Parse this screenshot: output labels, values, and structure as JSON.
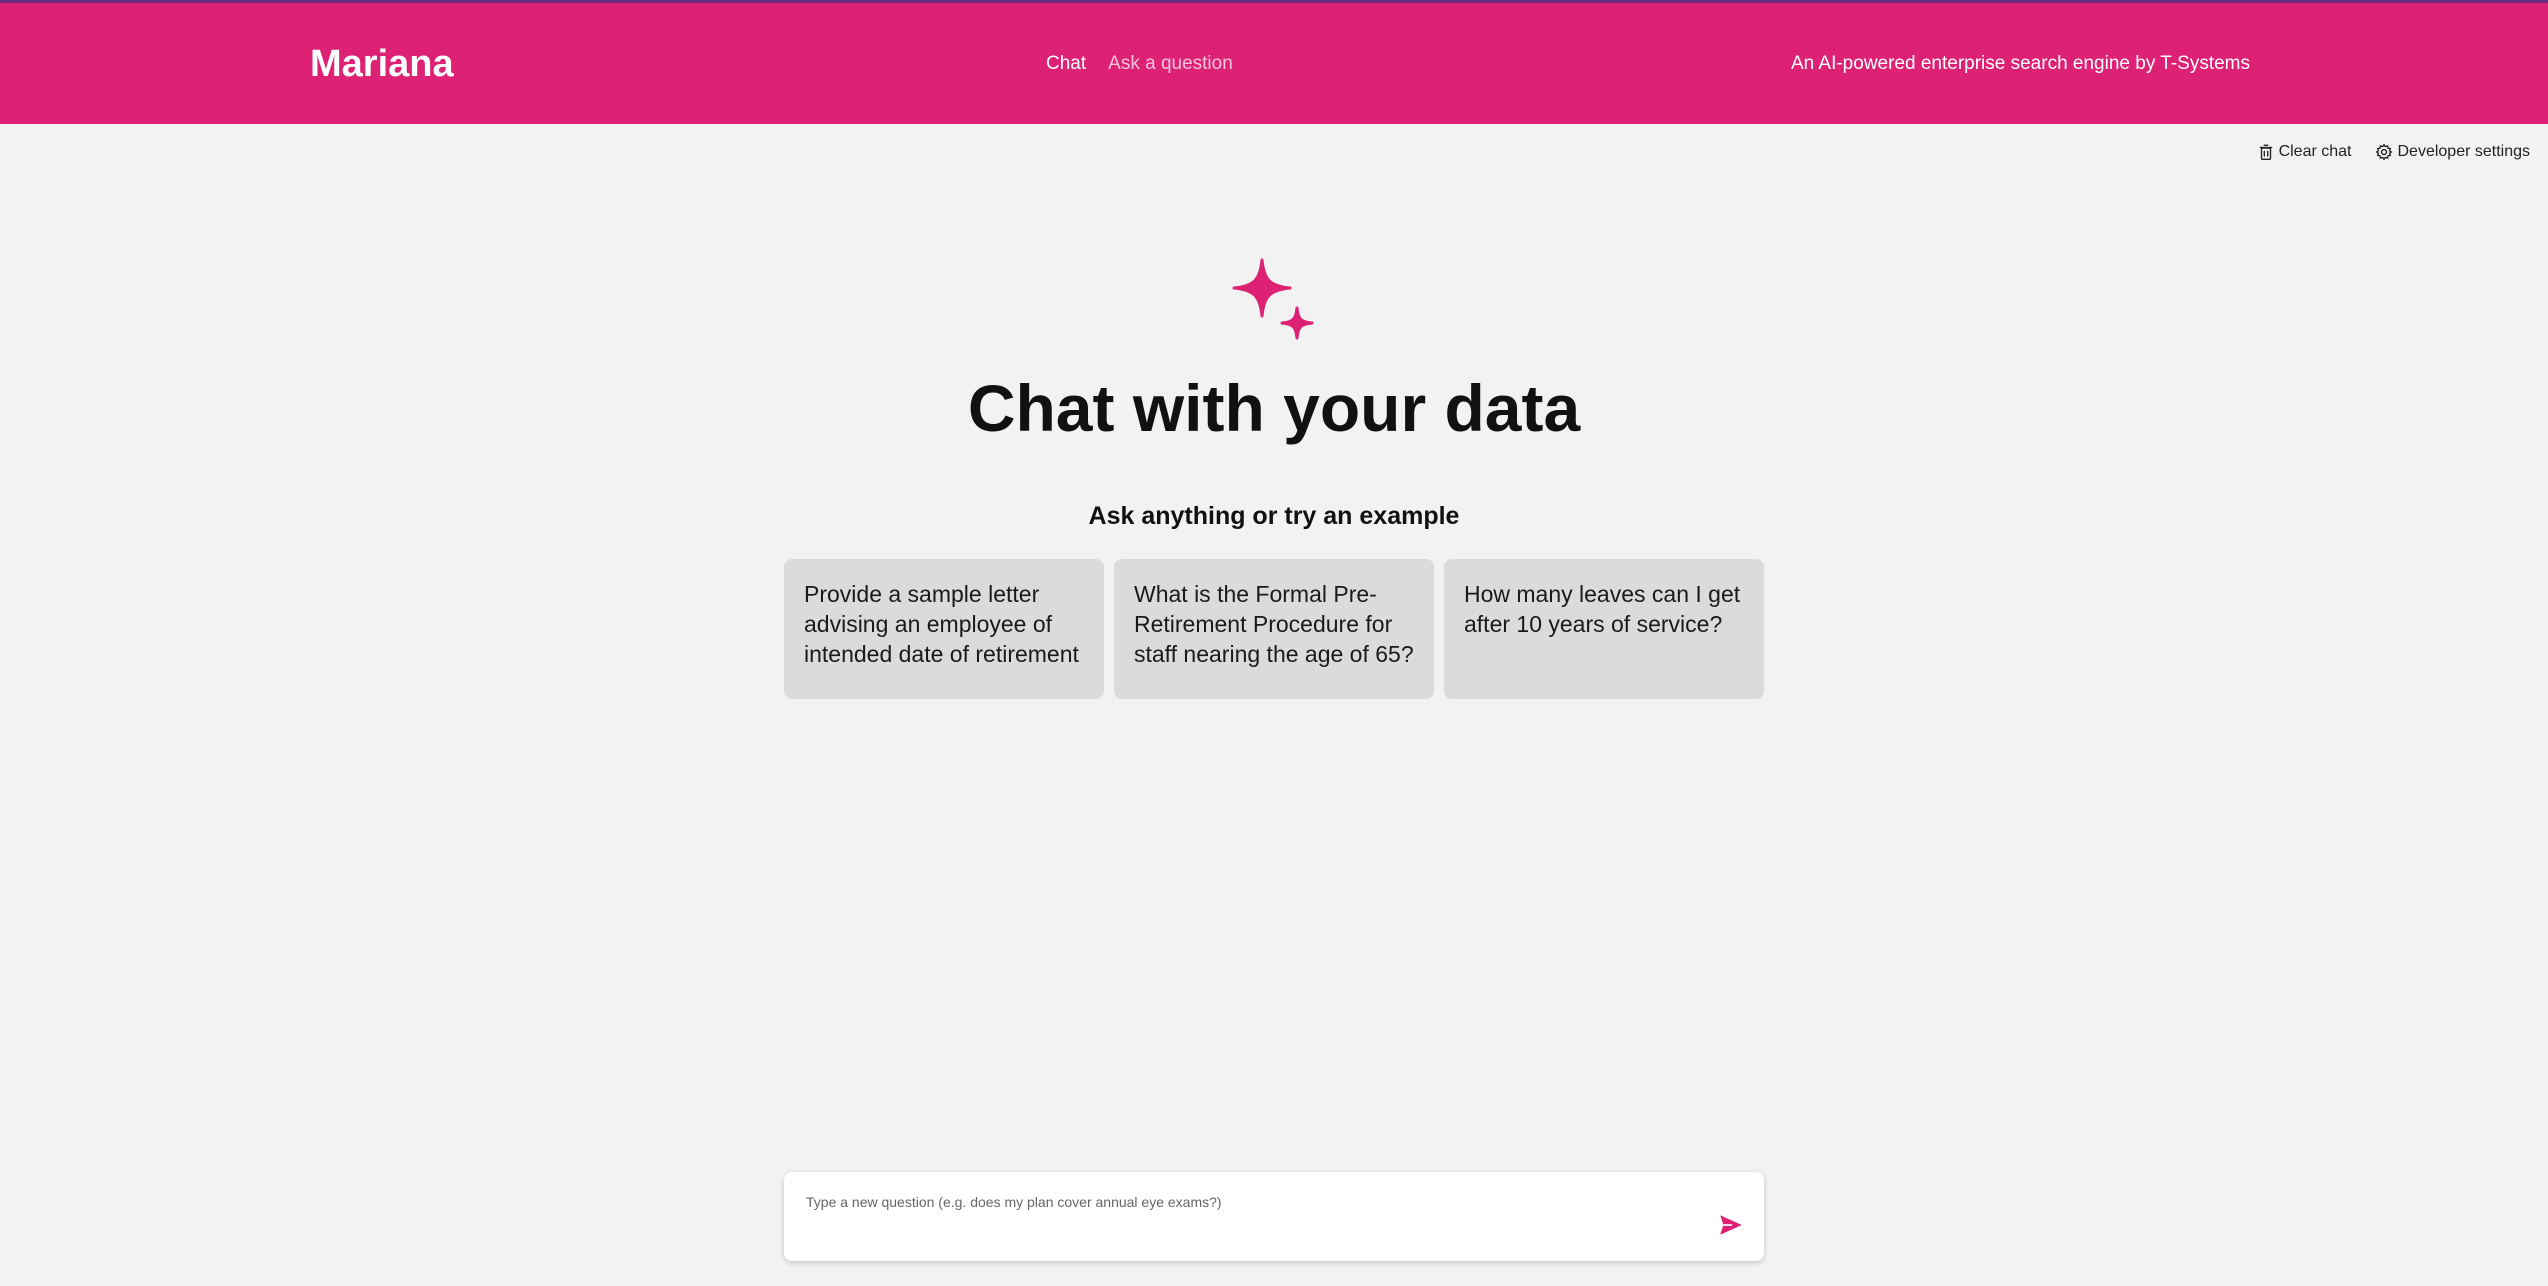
{
  "header": {
    "brand": "Mariana",
    "nav": [
      {
        "label": "Chat"
      },
      {
        "label": "Ask a question"
      }
    ],
    "tagline": "An AI-powered enterprise search engine by T-Systems"
  },
  "toolbar": {
    "clear_chat": "Clear chat",
    "developer_settings": "Developer settings"
  },
  "hero": {
    "icon": "sparkle-icon",
    "title": "Chat with your data",
    "subtitle": "Ask anything or try an example"
  },
  "examples": [
    {
      "text": "Provide a sample letter advising an employee of intended date of retirement"
    },
    {
      "text": "What is the Formal Pre-Retirement Procedure for staff nearing the age of 65?"
    },
    {
      "text": "How many leaves can I get after 10 years of service?"
    }
  ],
  "input": {
    "placeholder": "Type a new question (e.g. does my plan cover annual eye exams?)",
    "value": ""
  },
  "colors": {
    "brand": "#dd2174",
    "background": "#f2f2f2",
    "card": "#dbdbdb"
  }
}
